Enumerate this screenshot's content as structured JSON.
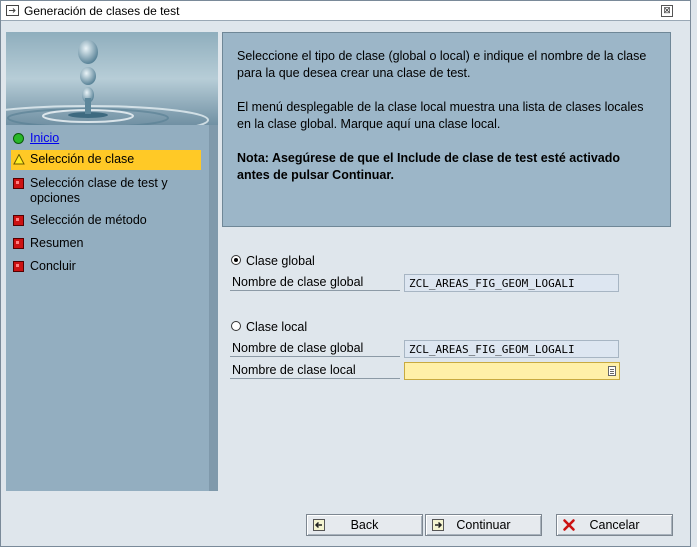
{
  "window": {
    "title": "Generación de clases de test",
    "close_glyph": "⊠"
  },
  "steps": [
    {
      "label": "Inicio",
      "state": "link",
      "icon": "green-circle-icon"
    },
    {
      "label": "Selección de clase",
      "state": "active",
      "icon": "yellow-warning-icon"
    },
    {
      "label": "Selección clase de test y opciones",
      "state": "pending",
      "icon": "red-square-icon"
    },
    {
      "label": "Selección de método",
      "state": "pending",
      "icon": "red-square-icon"
    },
    {
      "label": "Resumen",
      "state": "pending",
      "icon": "red-square-icon"
    },
    {
      "label": "Concluir",
      "state": "pending",
      "icon": "red-square-icon"
    }
  ],
  "info": {
    "p1": "Seleccione el tipo de clase (global o local) e indique el nombre de la clase para la que desea crear una clase de test.",
    "p2": "El menú desplegable de la clase local muestra una lista de clases locales en la clase global. Marque aquí una clase local.",
    "note": "Nota: Asegúrese de que el Include de clase de test esté activado antes de pulsar Continuar."
  },
  "global_option": {
    "radio_label": "Clase global",
    "selected": true,
    "field_label": "Nombre de clase global",
    "field_value": "ZCL_AREAS_FIG_GEOM_LOGALI"
  },
  "local_option": {
    "radio_label": "Clase local",
    "selected": false,
    "global_field_label": "Nombre de clase global",
    "global_field_value": "ZCL_AREAS_FIG_GEOM_LOGALI",
    "local_field_label": "Nombre de clase local",
    "local_field_value": ""
  },
  "buttons": {
    "back": "Back",
    "continue": "Continuar",
    "cancel": "Cancelar"
  },
  "colors": {
    "active_step": "#ffc926",
    "info_bg": "#9cb6c8",
    "input_required": "#fff0a8",
    "cancel_icon": "#cc1111"
  }
}
